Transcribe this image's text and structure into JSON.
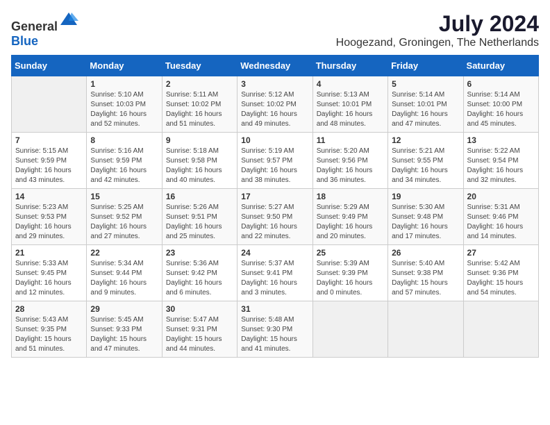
{
  "logo": {
    "text_general": "General",
    "text_blue": "Blue"
  },
  "title": "July 2024",
  "location": "Hoogezand, Groningen, The Netherlands",
  "days_of_week": [
    "Sunday",
    "Monday",
    "Tuesday",
    "Wednesday",
    "Thursday",
    "Friday",
    "Saturday"
  ],
  "weeks": [
    [
      {
        "day": "",
        "sunrise": "",
        "sunset": "",
        "daylight": ""
      },
      {
        "day": "1",
        "sunrise": "5:10 AM",
        "sunset": "10:03 PM",
        "daylight": "16 hours and 52 minutes."
      },
      {
        "day": "2",
        "sunrise": "5:11 AM",
        "sunset": "10:02 PM",
        "daylight": "16 hours and 51 minutes."
      },
      {
        "day": "3",
        "sunrise": "5:12 AM",
        "sunset": "10:02 PM",
        "daylight": "16 hours and 49 minutes."
      },
      {
        "day": "4",
        "sunrise": "5:13 AM",
        "sunset": "10:01 PM",
        "daylight": "16 hours and 48 minutes."
      },
      {
        "day": "5",
        "sunrise": "5:14 AM",
        "sunset": "10:01 PM",
        "daylight": "16 hours and 47 minutes."
      },
      {
        "day": "6",
        "sunrise": "5:14 AM",
        "sunset": "10:00 PM",
        "daylight": "16 hours and 45 minutes."
      }
    ],
    [
      {
        "day": "7",
        "sunrise": "5:15 AM",
        "sunset": "9:59 PM",
        "daylight": "16 hours and 43 minutes."
      },
      {
        "day": "8",
        "sunrise": "5:16 AM",
        "sunset": "9:59 PM",
        "daylight": "16 hours and 42 minutes."
      },
      {
        "day": "9",
        "sunrise": "5:18 AM",
        "sunset": "9:58 PM",
        "daylight": "16 hours and 40 minutes."
      },
      {
        "day": "10",
        "sunrise": "5:19 AM",
        "sunset": "9:57 PM",
        "daylight": "16 hours and 38 minutes."
      },
      {
        "day": "11",
        "sunrise": "5:20 AM",
        "sunset": "9:56 PM",
        "daylight": "16 hours and 36 minutes."
      },
      {
        "day": "12",
        "sunrise": "5:21 AM",
        "sunset": "9:55 PM",
        "daylight": "16 hours and 34 minutes."
      },
      {
        "day": "13",
        "sunrise": "5:22 AM",
        "sunset": "9:54 PM",
        "daylight": "16 hours and 32 minutes."
      }
    ],
    [
      {
        "day": "14",
        "sunrise": "5:23 AM",
        "sunset": "9:53 PM",
        "daylight": "16 hours and 29 minutes."
      },
      {
        "day": "15",
        "sunrise": "5:25 AM",
        "sunset": "9:52 PM",
        "daylight": "16 hours and 27 minutes."
      },
      {
        "day": "16",
        "sunrise": "5:26 AM",
        "sunset": "9:51 PM",
        "daylight": "16 hours and 25 minutes."
      },
      {
        "day": "17",
        "sunrise": "5:27 AM",
        "sunset": "9:50 PM",
        "daylight": "16 hours and 22 minutes."
      },
      {
        "day": "18",
        "sunrise": "5:29 AM",
        "sunset": "9:49 PM",
        "daylight": "16 hours and 20 minutes."
      },
      {
        "day": "19",
        "sunrise": "5:30 AM",
        "sunset": "9:48 PM",
        "daylight": "16 hours and 17 minutes."
      },
      {
        "day": "20",
        "sunrise": "5:31 AM",
        "sunset": "9:46 PM",
        "daylight": "16 hours and 14 minutes."
      }
    ],
    [
      {
        "day": "21",
        "sunrise": "5:33 AM",
        "sunset": "9:45 PM",
        "daylight": "16 hours and 12 minutes."
      },
      {
        "day": "22",
        "sunrise": "5:34 AM",
        "sunset": "9:44 PM",
        "daylight": "16 hours and 9 minutes."
      },
      {
        "day": "23",
        "sunrise": "5:36 AM",
        "sunset": "9:42 PM",
        "daylight": "16 hours and 6 minutes."
      },
      {
        "day": "24",
        "sunrise": "5:37 AM",
        "sunset": "9:41 PM",
        "daylight": "16 hours and 3 minutes."
      },
      {
        "day": "25",
        "sunrise": "5:39 AM",
        "sunset": "9:39 PM",
        "daylight": "16 hours and 0 minutes."
      },
      {
        "day": "26",
        "sunrise": "5:40 AM",
        "sunset": "9:38 PM",
        "daylight": "15 hours and 57 minutes."
      },
      {
        "day": "27",
        "sunrise": "5:42 AM",
        "sunset": "9:36 PM",
        "daylight": "15 hours and 54 minutes."
      }
    ],
    [
      {
        "day": "28",
        "sunrise": "5:43 AM",
        "sunset": "9:35 PM",
        "daylight": "15 hours and 51 minutes."
      },
      {
        "day": "29",
        "sunrise": "5:45 AM",
        "sunset": "9:33 PM",
        "daylight": "15 hours and 47 minutes."
      },
      {
        "day": "30",
        "sunrise": "5:47 AM",
        "sunset": "9:31 PM",
        "daylight": "15 hours and 44 minutes."
      },
      {
        "day": "31",
        "sunrise": "5:48 AM",
        "sunset": "9:30 PM",
        "daylight": "15 hours and 41 minutes."
      },
      {
        "day": "",
        "sunrise": "",
        "sunset": "",
        "daylight": ""
      },
      {
        "day": "",
        "sunrise": "",
        "sunset": "",
        "daylight": ""
      },
      {
        "day": "",
        "sunrise": "",
        "sunset": "",
        "daylight": ""
      }
    ]
  ]
}
